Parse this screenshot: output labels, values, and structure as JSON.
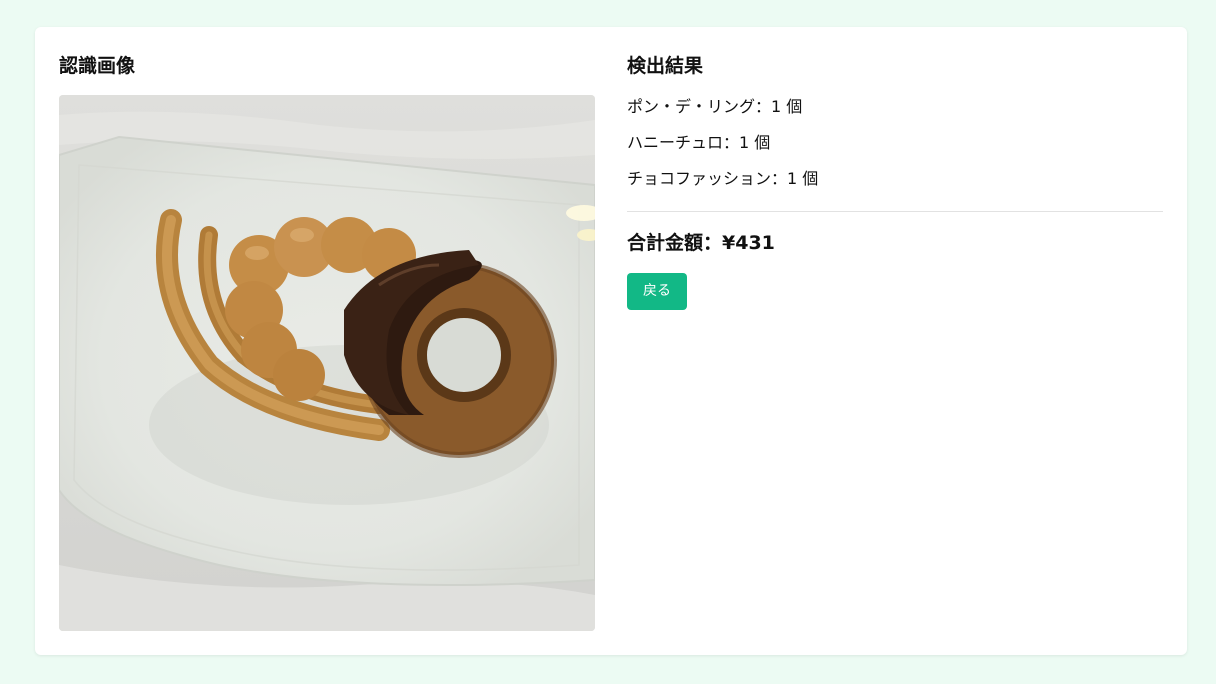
{
  "image_section": {
    "title": "認識画像",
    "image_alt": "donuts on a plate"
  },
  "results_section": {
    "title": "検出結果",
    "items": [
      {
        "text": "ポン・デ・リング：1 個"
      },
      {
        "text": "ハニーチュロ：1 個"
      },
      {
        "text": "チョコファッション：1 個"
      }
    ],
    "total_label": "合計金額：¥431",
    "back_label": "戻る"
  },
  "colors": {
    "page_background": "#ecfbf3",
    "card_background": "#ffffff",
    "button": "#12b886"
  }
}
